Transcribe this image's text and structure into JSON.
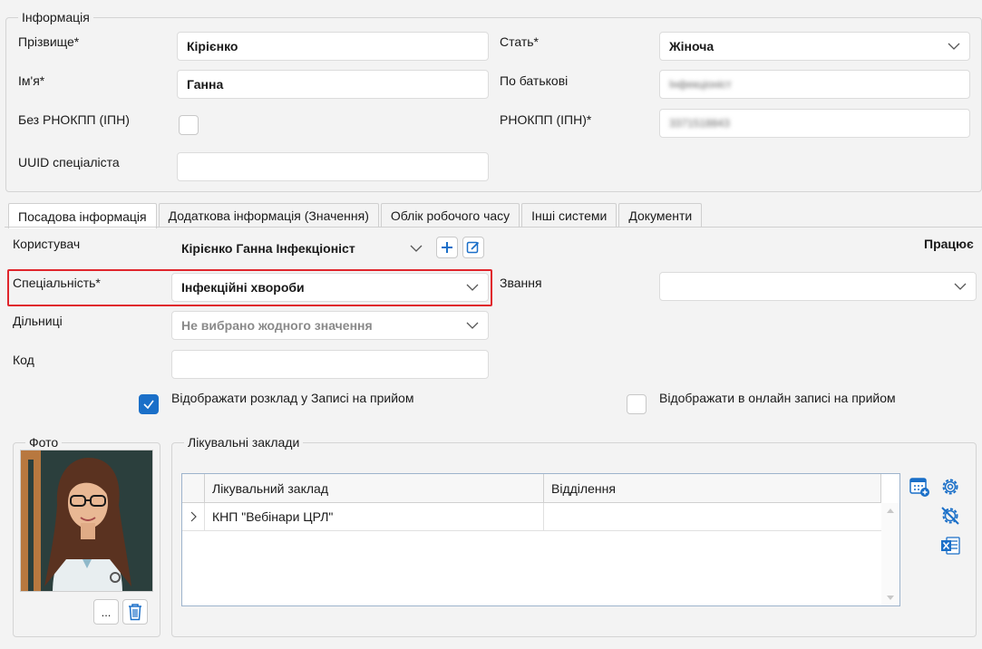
{
  "info": {
    "group_title": "Інформація",
    "surname_label": "Прізвище*",
    "surname_value": "Кірієнко",
    "name_label": "Ім'я*",
    "name_value": "Ганна",
    "no_tax_label": "Без РНОКПП (ІПН)",
    "uuid_label": "UUID спеціаліста",
    "uuid_value": "",
    "gender_label": "Стать*",
    "gender_value": "Жіноча",
    "patronymic_label": "По батькові",
    "patronymic_value": "Інфекціоніст",
    "tax_label": "РНОКПП (ІПН)*",
    "tax_value": "3371518843"
  },
  "tabs": [
    {
      "label": "Посадова інформація",
      "active": true
    },
    {
      "label": "Додаткова інформація (Значення)",
      "active": false
    },
    {
      "label": "Облік робочого часу",
      "active": false
    },
    {
      "label": "Інші системи",
      "active": false
    },
    {
      "label": "Документи",
      "active": false
    }
  ],
  "job": {
    "user_label": "Користувач",
    "user_value": "Кірієнко Ганна Інфекціоніст",
    "status_text": "Працює",
    "specialty_label": "Спеціальність*",
    "specialty_value": "Інфекційні хвороби",
    "rank_label": "Звання",
    "rank_value": "",
    "districts_label": "Дільниці",
    "districts_placeholder": "Не вибрано жодного значення",
    "code_label": "Код",
    "code_value": "",
    "show_schedule_label": "Відображати розклад у Записі на прийом",
    "show_schedule_checked": true,
    "show_online_label": "Відображати в онлайн записі на прийом",
    "show_online_checked": false
  },
  "photo": {
    "group_title": "Фото",
    "browse_label": "..."
  },
  "facilities": {
    "group_title": "Лікувальні заклади",
    "columns": [
      "Лікувальний заклад",
      "Відділення"
    ],
    "rows": [
      {
        "facility": "КНП \"Вебінари ЦРЛ\"",
        "department": ""
      }
    ]
  },
  "colors": {
    "accent": "#1a6fc8",
    "highlight": "#e0252c"
  }
}
